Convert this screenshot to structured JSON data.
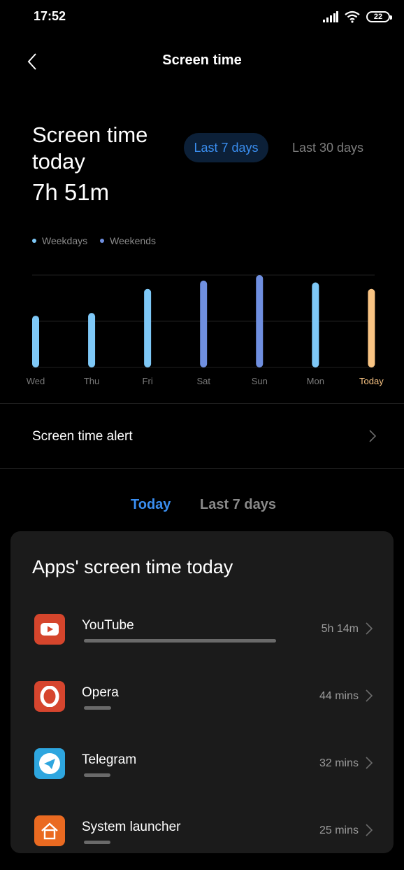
{
  "status_bar": {
    "time": "17:52",
    "battery": "22"
  },
  "header": {
    "title": "Screen time"
  },
  "summary": {
    "title": "Screen time today",
    "value": "7h 51m",
    "range_active": "Last 7 days",
    "range_other": "Last 30 days"
  },
  "legend": {
    "weekdays": "Weekdays",
    "weekends": "Weekends"
  },
  "colors": {
    "weekday": "#7ec8f7",
    "weekend": "#6f8fe0",
    "today": "#f9c483",
    "accent": "#3a8ef0",
    "youtube": "#d5452c",
    "opera": "#d6452e",
    "telegram": "#2ea6df",
    "launcher": "#ea6a21"
  },
  "chart_data": {
    "type": "bar",
    "categories": [
      "Wed",
      "Thu",
      "Fri",
      "Sat",
      "Sun",
      "Mon",
      "Today"
    ],
    "values": [
      0.56,
      0.59,
      0.85,
      0.94,
      1.0,
      0.92,
      0.85
    ],
    "kinds": [
      "weekday",
      "weekday",
      "weekday",
      "weekend",
      "weekend",
      "weekday",
      "today"
    ],
    "grid": true
  },
  "alert": {
    "label": "Screen time alert"
  },
  "tabs": {
    "active": "Today",
    "inactive": "Last 7 days"
  },
  "apps_card": {
    "title": "Apps' screen time today",
    "apps": [
      {
        "name": "YouTube",
        "time": "5h 14m",
        "icon": "youtube-icon",
        "share": 1.0
      },
      {
        "name": "Opera",
        "time": "44 mins",
        "icon": "opera-icon",
        "share": 0.14
      },
      {
        "name": "Telegram",
        "time": "32 mins",
        "icon": "telegram-icon",
        "share": 0.1
      },
      {
        "name": "System launcher",
        "time": "25 mins",
        "icon": "home-icon",
        "share": 0.08
      }
    ]
  }
}
